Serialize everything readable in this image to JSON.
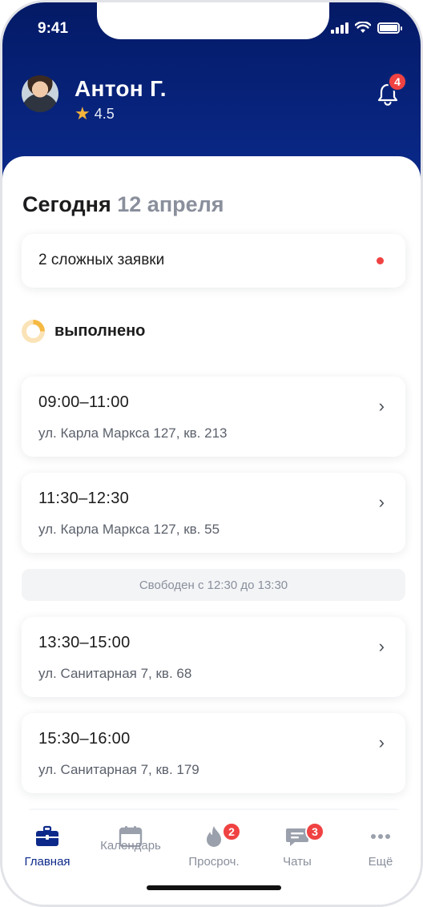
{
  "status_bar": {
    "time": "9:41"
  },
  "profile": {
    "name": "Антон Г.",
    "rating": "4.5",
    "notifications_count": "4"
  },
  "date": {
    "label": "Сегодня",
    "value": "12 апреля"
  },
  "complex_requests": {
    "text": "2 сложных заявки"
  },
  "progress": {
    "label": "выполнено",
    "fraction": 0.25
  },
  "appointments": [
    {
      "time": "09:00–11:00",
      "address": "ул. Карла Маркса 127, кв. 213"
    },
    {
      "time": "11:30–12:30",
      "address": "ул. Карла Маркса 127, кв. 55"
    },
    {
      "time": "13:30–15:00",
      "address": "ул. Санитарная 7, кв. 68"
    },
    {
      "time": "15:30–16:00",
      "address": "ул. Санитарная 7, кв. 179"
    }
  ],
  "free_slot": {
    "text": "Свободен с 12:30 до 13:30"
  },
  "tabs": [
    {
      "label": "Главная",
      "icon": "briefcase-icon",
      "active": true
    },
    {
      "label": "Календарь",
      "icon": "calendar-icon"
    },
    {
      "label": "Просроч.",
      "icon": "flame-icon",
      "badge": "2"
    },
    {
      "label": "Чаты",
      "icon": "chat-icon",
      "badge": "3"
    },
    {
      "label": "Ещё",
      "icon": "more-dots-icon"
    }
  ],
  "colors": {
    "header_bg": "#0a2a8c",
    "accent": "#0d2a8a",
    "badge": "#f04242",
    "star": "#f5b43a",
    "progress": "#f5b942"
  }
}
